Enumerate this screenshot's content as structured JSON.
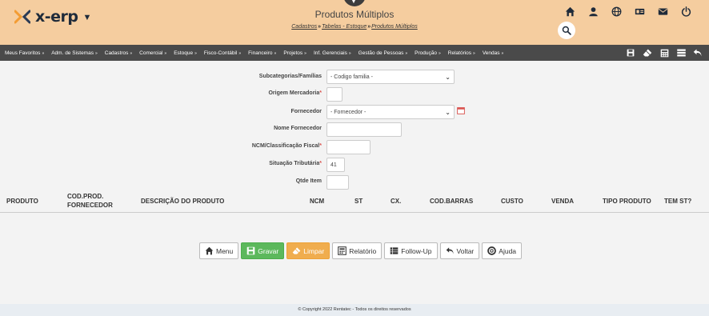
{
  "app": {
    "logo_text": "x-erp",
    "page_title": "Produtos Múltiplos",
    "breadcrumb": [
      "Cadastros",
      "Tabelas - Estoque",
      "Produtos Múltiplos"
    ],
    "breadcrumb_sep": "»"
  },
  "header_icons": [
    "home-icon",
    "user-icon",
    "globe-icon",
    "id-card-icon",
    "envelope-icon",
    "power-icon"
  ],
  "nav": {
    "items": [
      "Meus Favoritos",
      "Adm. de Sistemas",
      "Cadastros",
      "Comercial",
      "Estoque",
      "Fisco-Contábil",
      "Financeiro",
      "Projetos",
      "Inf. Gerenciais",
      "Gestão de Pessoas",
      "Produção",
      "Relatórios",
      "Vendas"
    ],
    "arrow": "»",
    "right_icons": [
      "save-icon",
      "eraser-icon",
      "calculator-icon",
      "list-icon",
      "undo-icon"
    ]
  },
  "form": {
    "subcategorias_label": "Subcategorias/Famílias",
    "subcategorias_value": "- Codigo familia -",
    "origem_label": "Origem Mercadoria",
    "origem_value": "",
    "fornecedor_label": "Fornecedor",
    "fornecedor_value": "- Fornecedor -",
    "nome_fornecedor_label": "Nome Fornecedor",
    "nome_fornecedor_value": "",
    "ncm_label": "NCM/Classificação Fiscal",
    "ncm_value": "",
    "situacao_label": "Situação Tributária",
    "situacao_value": "41",
    "qtde_label": "Qtde Item",
    "qtde_value": "",
    "required_mark": "*"
  },
  "table": {
    "headers": [
      "PRODUTO",
      "COD.PROD.",
      "FORNECEDOR",
      "DESCRIÇÃO DO PRODUTO",
      "NCM",
      "ST",
      "CX.",
      "COD.BARRAS",
      "CUSTO",
      "VENDA",
      "TIPO PRODUTO",
      "TEM ST?"
    ]
  },
  "buttons": {
    "menu": "Menu",
    "gravar": "Gravar",
    "limpar": "Limpar",
    "relatorio": "Relatório",
    "follow_up": "Follow-Up",
    "voltar": "Voltar",
    "ajuda": "Ajuda"
  },
  "footer": {
    "copyright": "© Copyright 2022 Rentatec - Todos os direitos reservados"
  },
  "colors": {
    "header_bg": "#f5cd9f",
    "nav_bg": "#4a4a4a",
    "logo_orange": "#f39c33",
    "gravar_green": "#5cb85c",
    "limpar_orange": "#f0ad4e"
  }
}
